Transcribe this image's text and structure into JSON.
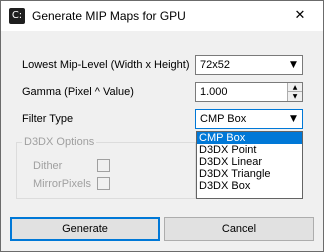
{
  "window": {
    "title": "Generate MIP Maps for GPU",
    "app_icon_glyph": "C:",
    "close_glyph": "✕"
  },
  "form": {
    "lowest_mip_label": "Lowest Mip-Level (Width x Height)",
    "lowest_mip_value": "72x52",
    "gamma_label": "Gamma (Pixel ^ Value)",
    "gamma_value": "1.000",
    "filter_type_label": "Filter Type",
    "filter_type_value": "CMP  Box"
  },
  "filter_dropdown": {
    "options": [
      "CMP  Box",
      "D3DX Point",
      "D3DX Linear",
      "D3DX Triangle",
      "D3DX Box"
    ],
    "selected_index": 0
  },
  "d3dx_options": {
    "title": "D3DX Options",
    "dither_label": "Dither",
    "dither_checked": false,
    "mirror_label": "MirrorPixels",
    "mirror_checked": false
  },
  "buttons": {
    "generate": "Generate",
    "cancel": "Cancel"
  },
  "icons": {
    "dropdown_arrow": "▼",
    "spin_up": "▲",
    "spin_down": "▼"
  }
}
